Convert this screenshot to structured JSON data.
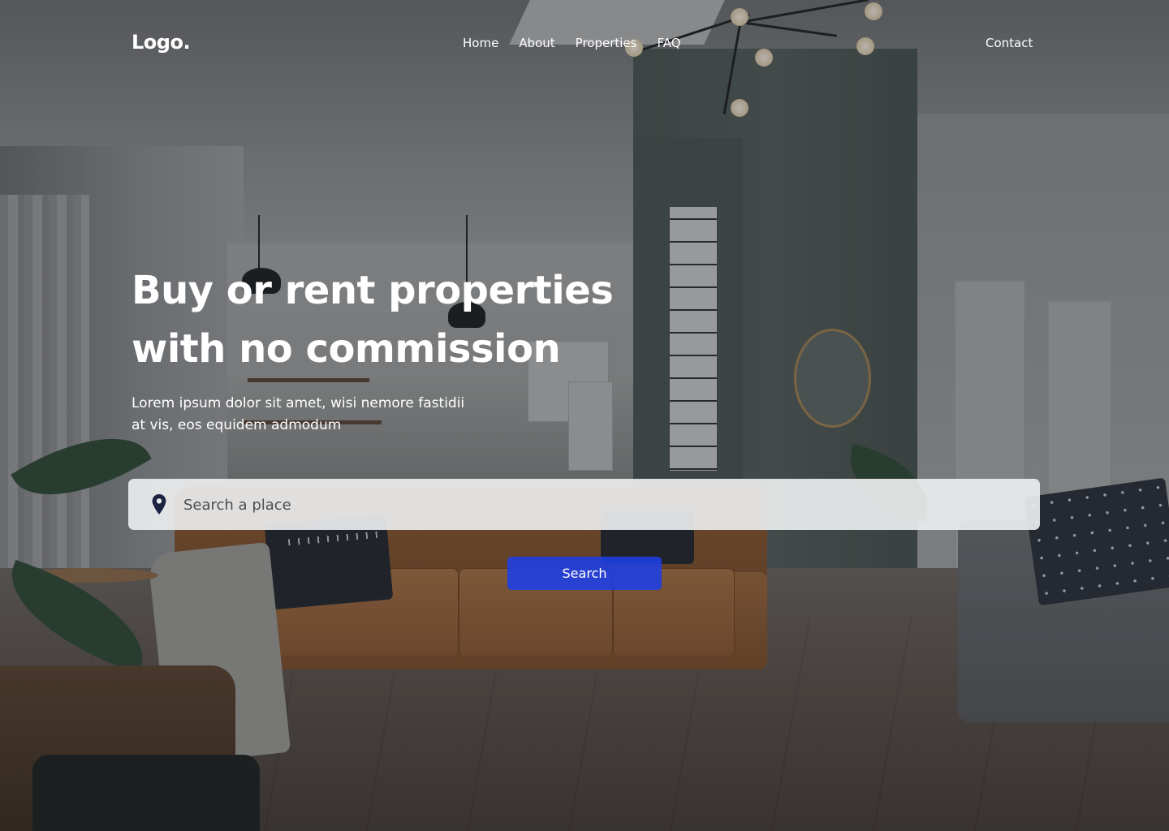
{
  "header": {
    "logo": "Logo.",
    "nav": [
      "Home",
      "About",
      "Properties",
      "FAQ"
    ],
    "contact": "Contact"
  },
  "hero": {
    "title_lines": [
      "Buy or rent properties",
      "with no commission"
    ],
    "subtitle_lines": [
      "Lorem ipsum dolor sit amet, wisi nemore fastidii",
      "at vis, eos equidem admodum"
    ]
  },
  "search": {
    "placeholder": "Search a place",
    "value": "",
    "button_label": "Search",
    "icon": "location-pin-icon"
  },
  "colors": {
    "accent": "#1e3fe6",
    "text": "#ffffff",
    "search_bg": "#ecedee",
    "pin": "#1c2340"
  }
}
